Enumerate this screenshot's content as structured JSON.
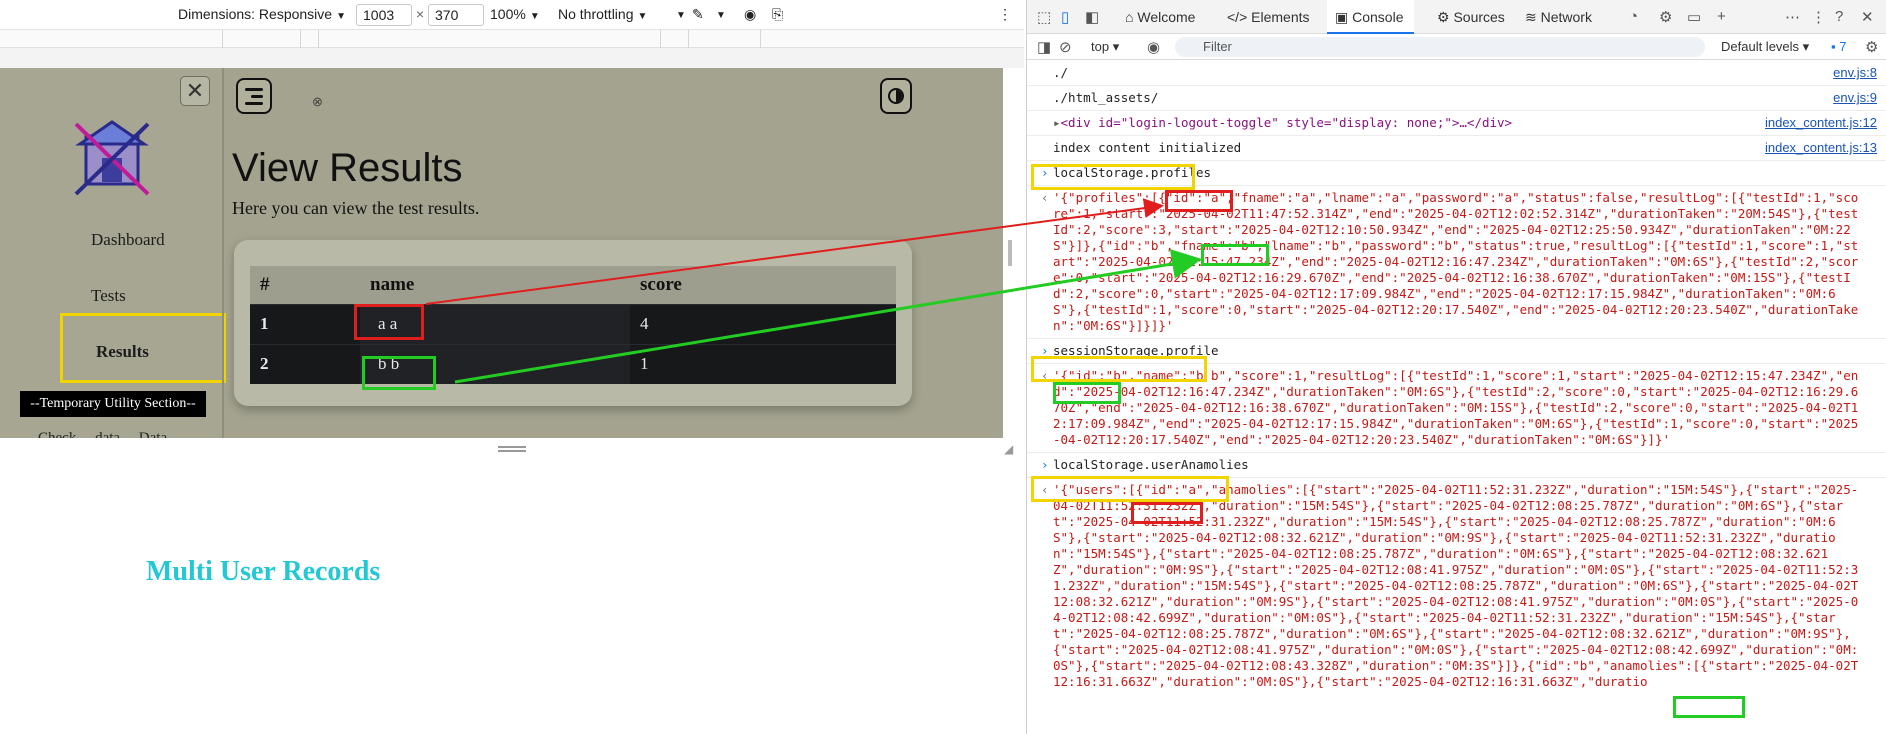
{
  "emulation_bar": {
    "dimensions_label": "Dimensions: Responsive",
    "width": "1003",
    "times": "×",
    "height": "370",
    "zoom": "100%",
    "throttling": "No throttling"
  },
  "app": {
    "sidebar": {
      "links": [
        "Dashboard",
        "Tests",
        "Results"
      ],
      "utility_section": "--Temporary Utility Section--",
      "cutoff_text": "Check ... data ... Data"
    },
    "title": "View Results",
    "subtitle": "Here you can view the test results.",
    "table": {
      "headers": [
        "#",
        "name",
        "score"
      ],
      "rows": [
        {
          "num": "1",
          "name": "a a",
          "score": "4"
        },
        {
          "num": "2",
          "name": "b b",
          "score": "1"
        }
      ]
    }
  },
  "caption": "Multi User Records",
  "devtools": {
    "tabs": [
      "Welcome",
      "Elements",
      "Console",
      "Sources",
      "Network"
    ],
    "active_tab": "Console",
    "context": "top",
    "filter_placeholder": "Filter",
    "levels": "Default levels",
    "issue_count": "7",
    "console_lines": [
      {
        "text": "./",
        "src": "env.js:8"
      },
      {
        "text": "./html_assets/",
        "src": "env.js:9"
      },
      {
        "text": "<div id=\"login-logout-toggle\" style=\"display: none;\">…</div>",
        "src": "index_content.js:12"
      },
      {
        "text": "index content initialized",
        "src": "index_content.js:13"
      }
    ],
    "cmd_profiles": "localStorage.profiles",
    "out_profiles": "'{\"profiles\":[{\"id\":\"a\",\"fname\":\"a\",\"lname\":\"a\",\"password\":\"a\",\"status\":false,\"resultLog\":[{\"testId\":1,\"score\":1,\"start\":\"2025-04-02T11:47:52.314Z\",\"end\":\"2025-04-02T12:02:52.314Z\",\"durationTaken\":\"20M:54S\"},{\"testId\":2,\"score\":3,\"start\":\"2025-04-02T12:10:50.934Z\",\"end\":\"2025-04-02T12:25:50.934Z\",\"durationTaken\":\"0M:22S\"}]},{\"id\":\"b\",\"fname\":\"b\",\"lname\":\"b\",\"password\":\"b\",\"status\":true,\"resultLog\":[{\"testId\":1,\"score\":1,\"start\":\"2025-04-02T12:15:47.234Z\",\"end\":\"2025-04-02T12:16:47.234Z\",\"durationTaken\":\"0M:6S\"},{\"testId\":2,\"score\":0,\"start\":\"2025-04-02T12:16:29.670Z\",\"end\":\"2025-04-02T12:16:38.670Z\",\"durationTaken\":\"0M:15S\"},{\"testId\":2,\"score\":0,\"start\":\"2025-04-02T12:17:09.984Z\",\"end\":\"2025-04-02T12:17:15.984Z\",\"durationTaken\":\"0M:6S\"},{\"testId\":1,\"score\":0,\"start\":\"2025-04-02T12:20:17.540Z\",\"end\":\"2025-04-02T12:20:23.540Z\",\"durationTaken\":\"0M:6S\"}]}]}'",
    "cmd_session": "sessionStorage.profile",
    "out_session": "'{\"id\":\"b\",\"name\":\"b b\",\"score\":1,\"resultLog\":[{\"testId\":1,\"score\":1,\"start\":\"2025-04-02T12:15:47.234Z\",\"end\":\"2025-04-02T12:16:47.234Z\",\"durationTaken\":\"0M:6S\"},{\"testId\":2,\"score\":0,\"start\":\"2025-04-02T12:16:29.670Z\",\"end\":\"2025-04-02T12:16:38.670Z\",\"durationTaken\":\"0M:15S\"},{\"testId\":2,\"score\":0,\"start\":\"2025-04-02T12:17:09.984Z\",\"end\":\"2025-04-02T12:17:15.984Z\",\"durationTaken\":\"0M:6S\"},{\"testId\":1,\"score\":0,\"start\":\"2025-04-02T12:20:17.540Z\",\"end\":\"2025-04-02T12:20:23.540Z\",\"durationTaken\":\"0M:6S\"}]}'",
    "cmd_anomalies": "localStorage.userAnamolies",
    "out_anomalies": "'{\"users\":[{\"id\":\"a\",\"anamolies\":[{\"start\":\"2025-04-02T11:52:31.232Z\",\"duration\":\"15M:54S\"},{\"start\":\"2025-04-02T11:52:31.232Z\",\"duration\":\"15M:54S\"},{\"start\":\"2025-04-02T12:08:25.787Z\",\"duration\":\"0M:6S\"},{\"start\":\"2025-04-02T11:52:31.232Z\",\"duration\":\"15M:54S\"},{\"start\":\"2025-04-02T12:08:25.787Z\",\"duration\":\"0M:6S\"},{\"start\":\"2025-04-02T12:08:32.621Z\",\"duration\":\"0M:9S\"},{\"start\":\"2025-04-02T11:52:31.232Z\",\"duration\":\"15M:54S\"},{\"start\":\"2025-04-02T12:08:25.787Z\",\"duration\":\"0M:6S\"},{\"start\":\"2025-04-02T12:08:32.621Z\",\"duration\":\"0M:9S\"},{\"start\":\"2025-04-02T12:08:41.975Z\",\"duration\":\"0M:0S\"},{\"start\":\"2025-04-02T11:52:31.232Z\",\"duration\":\"15M:54S\"},{\"start\":\"2025-04-02T12:08:25.787Z\",\"duration\":\"0M:6S\"},{\"start\":\"2025-04-02T12:08:32.621Z\",\"duration\":\"0M:9S\"},{\"start\":\"2025-04-02T12:08:41.975Z\",\"duration\":\"0M:0S\"},{\"start\":\"2025-04-02T12:08:42.699Z\",\"duration\":\"0M:0S\"},{\"start\":\"2025-04-02T11:52:31.232Z\",\"duration\":\"15M:54S\"},{\"start\":\"2025-04-02T12:08:25.787Z\",\"duration\":\"0M:6S\"},{\"start\":\"2025-04-02T12:08:32.621Z\",\"duration\":\"0M:9S\"},{\"start\":\"2025-04-02T12:08:41.975Z\",\"duration\":\"0M:0S\"},{\"start\":\"2025-04-02T12:08:42.699Z\",\"duration\":\"0M:0S\"},{\"start\":\"2025-04-02T12:08:43.328Z\",\"duration\":\"0M:3S\"}]},{\"id\":\"b\",\"anamolies\":[{\"start\":\"2025-04-02T12:16:31.663Z\",\"duration\":\"0M:0S\"},{\"start\":\"2025-04-02T12:16:31.663Z\",\"duratio"
  }
}
